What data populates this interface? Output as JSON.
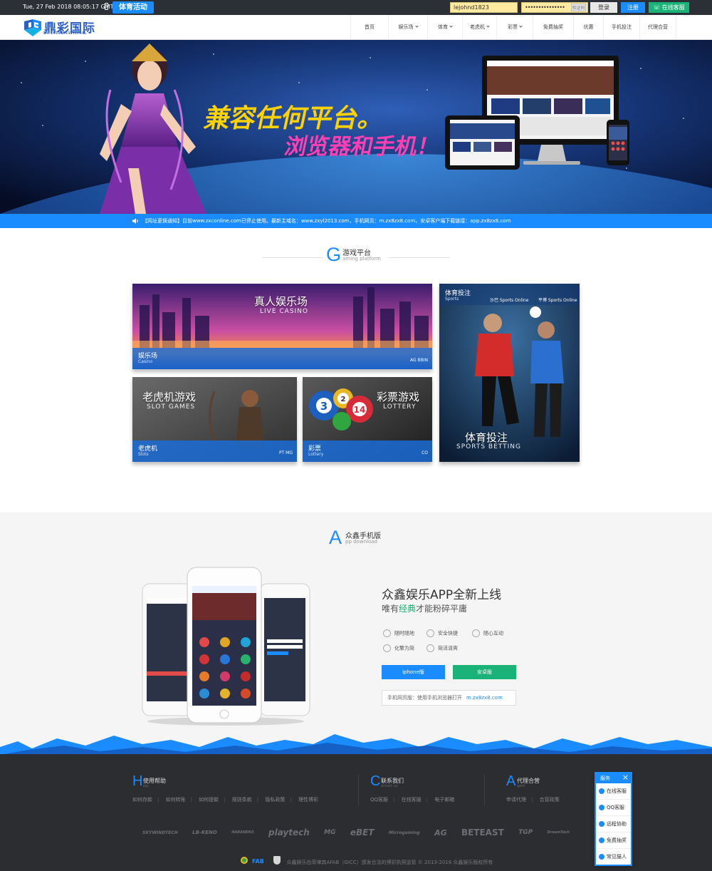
{
  "topbar": {
    "datetime": "Tue, 27 Feb 2018 08:05:17 GMT",
    "promo_label": "体育活动",
    "username_value": "lejohnd1823",
    "password_value": "•••••••••••••••",
    "captcha_label": "验证码",
    "login_label": "登录",
    "register_label": "注册",
    "service_label": "在线客服"
  },
  "logo": {
    "name": "鼎彩国际",
    "sub": "DC INTERNATIONAL"
  },
  "nav": [
    {
      "label": "首页",
      "has_dropdown": false
    },
    {
      "label": "娱乐场",
      "has_dropdown": true
    },
    {
      "label": "体育",
      "has_dropdown": true
    },
    {
      "label": "老虎机",
      "has_dropdown": true
    },
    {
      "label": "彩票",
      "has_dropdown": true
    },
    {
      "label": "免费抽奖",
      "has_dropdown": false
    },
    {
      "label": "优惠",
      "has_dropdown": false
    },
    {
      "label": "手机投注",
      "has_dropdown": false
    },
    {
      "label": "代理合营",
      "has_dropdown": false
    }
  ],
  "banner": {
    "headline1": "兼容任何平台。",
    "headline2": "浏览器和手机！",
    "dot_count": 11
  },
  "notice": {
    "text": "【网址更换通知】目前www.zxconline.com已停止使用。最新主域名：www.zxyl2013.com，手机网页：m.zx8zx8.com，安卓客户端下载链接：app.zx8zx8.com"
  },
  "gaming": {
    "letter": "G",
    "title": "游戏平台",
    "subtitle": "aming platform",
    "cards": {
      "casino": {
        "t1": "真人娱乐场",
        "t2": "LIVE CASINO",
        "label": "娱乐场",
        "label_en": "Casino",
        "providers": "AG   BBIN"
      },
      "sports": {
        "t1": "体育投注",
        "t2": "SPORTS BETTING",
        "label": "体育投注",
        "label_en": "Sports",
        "p1": "沙巴 Sports Online",
        "p2": "平博 Sports Online"
      },
      "slots": {
        "t1": "老虎机游戏",
        "t2": "SLOT GAMES",
        "label": "老虎机",
        "label_en": "Slots",
        "providers": "PT   MG"
      },
      "lottery": {
        "t1": "彩票游戏",
        "t2": "LOTTERY",
        "label": "彩票",
        "label_en": "Lottery",
        "providers": "CO",
        "balls": [
          "3",
          "2",
          "14"
        ]
      }
    }
  },
  "app": {
    "letter": "A",
    "title": "众鑫手机版",
    "subtitle": "pp download",
    "headline": "众鑫娱乐APP全新上线",
    "sub_pre": "唯有",
    "sub_hl": "经典",
    "sub_post": "才能粉碎平庸",
    "features": [
      "随时随地",
      "安全快捷",
      "随心互动",
      "化繁为简",
      "简洁清爽"
    ],
    "ios_label": "iphone版",
    "android_label": "安卓版",
    "mobile_web_label": "手机网页版：使用手机浏览器打开",
    "mobile_web_url": "m.zx8zx8.com"
  },
  "footer": {
    "help": {
      "letter": "H",
      "title": "使用帮助",
      "en": "elp",
      "links": [
        "如何存款",
        "如何转账",
        "如何提款",
        "规则条款",
        "隐私政策",
        "理性博彩"
      ]
    },
    "contact": {
      "letter": "C",
      "title": "联系我们",
      "en": "ontact us",
      "links": [
        "QQ客服",
        "在线客服",
        "电子邮箱"
      ]
    },
    "agent": {
      "letter": "A",
      "title": "代理合营",
      "en": "gent",
      "links": [
        "申请代理",
        "合营政策"
      ]
    },
    "partners": [
      "SKYWINDTECH",
      "LB-KENO",
      "HABANERO",
      "playtech",
      "MG",
      "eBET",
      "Microgaming",
      "AG",
      "BETEAST",
      "TGP",
      "DreamTech"
    ],
    "fab_label": "FAB",
    "copyright": "众鑫娱乐由菲律宾AFAB（GICC）颁发合法的博彩执照监管 © 2013-2018 众鑫娱乐版权所有"
  },
  "service_panel": {
    "title": "服务",
    "items": [
      "在线客服",
      "QQ客服",
      "远程协助",
      "免费抽奖",
      "常见猫人"
    ]
  },
  "colors": {
    "accent": "#1a8cff",
    "green": "#19b377",
    "dark": "#2b2d31"
  }
}
